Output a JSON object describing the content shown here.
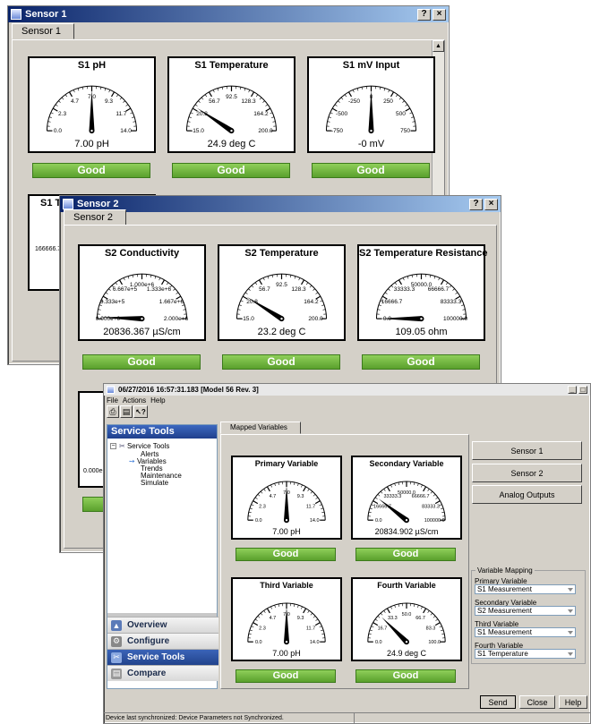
{
  "windows": {
    "sensor1": {
      "title": "Sensor 1",
      "tab": "Sensor 1",
      "help_btn": "?",
      "close_btn": "×",
      "gauges": [
        {
          "title": "S1 pH",
          "readout": "7.00 pH",
          "min": 0,
          "max": 14,
          "value": 7.0,
          "ticks": [
            "0.0",
            "2.3",
            "4.7",
            "7.0",
            "9.3",
            "11.7",
            "14.0"
          ],
          "status": "Good"
        },
        {
          "title": "S1 Temperature",
          "readout": "24.9 deg C",
          "min": -15,
          "max": 200,
          "value": 24.9,
          "ticks": [
            "-15.0",
            "20.8",
            "56.7",
            "92.5",
            "128.3",
            "164.2",
            "200.0"
          ],
          "status": "Good"
        },
        {
          "title": "S1 mV Input",
          "readout": "-0 mV",
          "min": -750,
          "max": 750,
          "value": 0,
          "ticks": [
            "-750",
            "-500",
            "-250",
            "0",
            "250",
            "500",
            "750"
          ],
          "status": "Good"
        }
      ],
      "partial_gauge_title": "S1 Te",
      "partial_tick": "166666.7"
    },
    "sensor2": {
      "title": "Sensor 2",
      "tab": "Sensor 2",
      "help_btn": "?",
      "close_btn": "×",
      "gauges": [
        {
          "title": "S2 Conductivity",
          "readout": "20836.367 µS/cm",
          "min": 0,
          "max": 2000000,
          "value": 20836.367,
          "ticks": [
            "0.000e+0",
            "3.333e+5",
            "6.667e+5",
            "1.000e+6",
            "1.333e+6",
            "1.667e+6",
            "2.000e+6"
          ],
          "status": "Good"
        },
        {
          "title": "S2 Temperature",
          "readout": "23.2 deg C",
          "min": -15,
          "max": 200,
          "value": 23.2,
          "ticks": [
            "-15.0",
            "20.8",
            "56.7",
            "92.5",
            "128.3",
            "164.2",
            "200.0"
          ],
          "status": "Good"
        },
        {
          "title": "S2 Temperature Resistance",
          "readout": "109.05 ohm",
          "min": 0,
          "max": 100000,
          "value": 109.05,
          "ticks": [
            "0.0",
            "16666.7",
            "33333.3",
            "50000.0",
            "66666.7",
            "83333.3",
            "100000.0"
          ],
          "status": "Good"
        }
      ],
      "partial_tick": "0.000e+0"
    },
    "main": {
      "title": "06/27/2016 16:57:31.183 [Model 56 Rev. 3]",
      "menu": [
        "File",
        "Actions",
        "Help"
      ],
      "min_btn": "_",
      "max_btn": "□",
      "sidebar_header": "Service Tools",
      "tree": {
        "root": "Service Tools",
        "children": [
          "Alerts",
          "Variables",
          "Trends",
          "Maintenance",
          "Simulate"
        ],
        "selected": "Variables"
      },
      "nav": [
        "Overview",
        "Configure",
        "Service Tools",
        "Compare"
      ],
      "nav_active": "Service Tools",
      "tab": "Mapped Variables",
      "gauges": [
        {
          "title": "Primary Variable",
          "readout": "7.00 pH",
          "min": 0,
          "max": 14,
          "value": 7.0,
          "ticks": [
            "0.0",
            "2.3",
            "4.7",
            "7.0",
            "9.3",
            "11.7",
            "14.0"
          ],
          "status": "Good"
        },
        {
          "title": "Secondary Variable",
          "readout": "20834.902 µS/cm",
          "min": 0,
          "max": 100000,
          "value": 20834.902,
          "ticks": [
            "0.0",
            "16666.7",
            "33333.3",
            "50000.0",
            "66666.7",
            "83333.3",
            "100000.0"
          ],
          "status": "Good"
        },
        {
          "title": "Third Variable",
          "readout": "7.00 pH",
          "min": 0,
          "max": 14,
          "value": 7.0,
          "ticks": [
            "0.0",
            "2.3",
            "4.7",
            "7.0",
            "9.3",
            "11.7",
            "14.0"
          ],
          "status": "Good"
        },
        {
          "title": "Fourth Variable",
          "readout": "24.9 deg C",
          "min": 0,
          "max": 100,
          "value": 24.9,
          "ticks": [
            "0.0",
            "16.7",
            "33.3",
            "50.0",
            "66.7",
            "83.3",
            "100.0"
          ],
          "status": "Good"
        }
      ],
      "right_buttons": [
        "Sensor 1",
        "Sensor 2",
        "Analog Outputs"
      ],
      "mapping": {
        "legend": "Variable Mapping",
        "rows": [
          {
            "label": "Primary Variable",
            "value": "S1 Measurement"
          },
          {
            "label": "Secondary Variable",
            "value": "S2 Measurement"
          },
          {
            "label": "Third Variable",
            "value": "S1 Measurement"
          },
          {
            "label": "Fourth Variable",
            "value": "S1 Temperature"
          }
        ]
      },
      "bottom_buttons": {
        "send": "Send",
        "close": "Close",
        "help": "Help"
      },
      "status_text": "Device last synchronized: Device Parameters not Synchronized."
    }
  },
  "colors": {
    "good": "#5aa02c",
    "titlebar": "#0a246a",
    "nav_active": "#22438c"
  }
}
